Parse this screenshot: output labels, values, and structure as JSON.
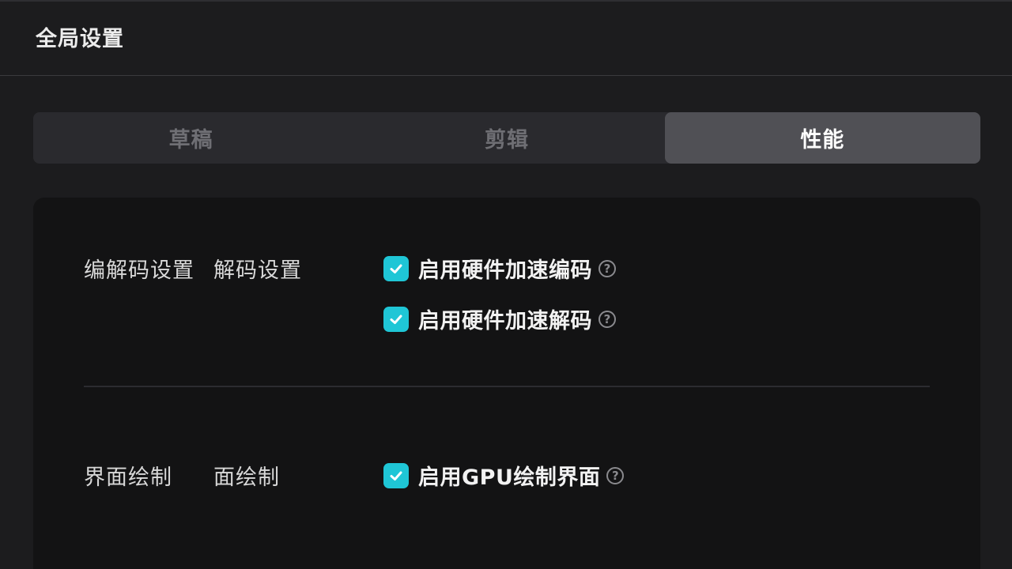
{
  "header": {
    "title": "全局设置"
  },
  "tabs": [
    {
      "label": "草稿",
      "active": false
    },
    {
      "label": "剪辑",
      "active": false
    },
    {
      "label": "性能",
      "active": true
    }
  ],
  "sections": {
    "codec": {
      "label": "编解码设置",
      "sublabel": "解码设置",
      "options": [
        {
          "label": "启用硬件加速编码",
          "checked": true
        },
        {
          "label": "启用硬件加速解码",
          "checked": true
        }
      ]
    },
    "render": {
      "label": "界面绘制",
      "sublabel": "面绘制",
      "options": [
        {
          "label": "启用GPU绘制界面",
          "checked": true
        }
      ]
    }
  },
  "help_glyph": "?",
  "colors": {
    "checkbox": "#1fc6d6",
    "active_tab": "#505055",
    "panel": "#131314"
  }
}
